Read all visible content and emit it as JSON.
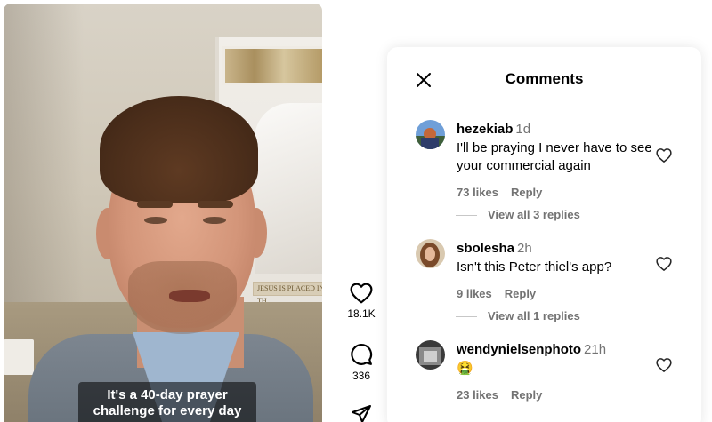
{
  "video": {
    "caption_line1": "It's a 40-day prayer",
    "caption_line2": "challenge for every day",
    "plaque_text": "JESUS IS PLACED IN TH"
  },
  "actions": {
    "like_count": "18.1K",
    "comment_count": "336",
    "like_icon": "heart-icon",
    "comment_icon": "speech-bubble-icon",
    "share_icon": "paper-plane-icon"
  },
  "comments_panel": {
    "title": "Comments",
    "close_icon": "close-icon",
    "comments": [
      {
        "username": "hezekiab",
        "time": "1d",
        "text_line1": "I'll be praying I never have to see",
        "text_line2": "your commercial again",
        "likes": "73 likes",
        "reply_label": "Reply",
        "view_replies": "View all 3 replies"
      },
      {
        "username": "sbolesha",
        "time": "2h",
        "text_line1": "Isn't this Peter thiel's app?",
        "likes": "9 likes",
        "reply_label": "Reply",
        "view_replies": "View all 1 replies"
      },
      {
        "username": "wendynielsenphoto",
        "time": "21h",
        "text_line1": "🤮",
        "likes": "23 likes",
        "reply_label": "Reply"
      }
    ]
  },
  "colors": {
    "secondary_text": "#737373",
    "primary_text": "#000000",
    "panel_bg": "#ffffff"
  }
}
